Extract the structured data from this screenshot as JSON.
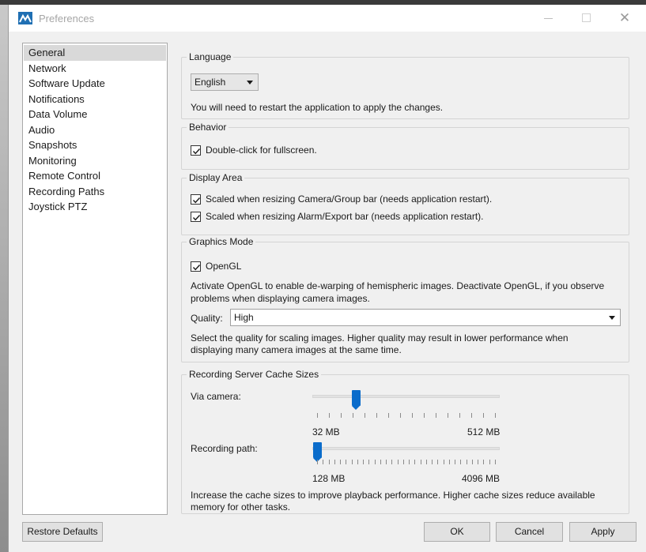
{
  "window": {
    "title": "Preferences",
    "icon": "milestone-logo-icon"
  },
  "sidebar": {
    "items": [
      {
        "label": "General",
        "selected": true
      },
      {
        "label": "Network"
      },
      {
        "label": "Software Update"
      },
      {
        "label": "Notifications"
      },
      {
        "label": "Data Volume"
      },
      {
        "label": "Audio"
      },
      {
        "label": "Snapshots"
      },
      {
        "label": "Monitoring"
      },
      {
        "label": "Remote Control"
      },
      {
        "label": "Recording Paths"
      },
      {
        "label": "Joystick PTZ"
      }
    ]
  },
  "language": {
    "title": "Language",
    "selected": "English",
    "note": "You will need to restart the application to apply the changes."
  },
  "behavior": {
    "title": "Behavior",
    "double_click_label": "Double-click for fullscreen.",
    "double_click_checked": true
  },
  "display_area": {
    "title": "Display Area",
    "camera_bar_label": "Scaled when resizing Camera/Group bar (needs application restart).",
    "camera_bar_checked": true,
    "alarm_bar_label": "Scaled when resizing Alarm/Export bar (needs application restart).",
    "alarm_bar_checked": true
  },
  "graphics": {
    "title": "Graphics Mode",
    "opengl_label": "OpenGL",
    "opengl_checked": true,
    "opengl_desc_1": "Activate OpenGL to enable de-warping of hemispheric images. Deactivate OpenGL, if you observe",
    "opengl_desc_2": "problems when displaying camera images.",
    "quality_label": "Quality:",
    "quality_value": "High",
    "quality_desc_1": "Select the quality for scaling images. Higher quality may result in lower performance when",
    "quality_desc_2": "displaying many camera images at the same time."
  },
  "cache": {
    "title": "Recording Server Cache Sizes",
    "via_camera_label": "Via camera:",
    "via_camera_min": "32 MB",
    "via_camera_max": "512 MB",
    "via_camera_level": 0.22,
    "recording_path_label": "Recording path:",
    "recording_path_min": "128 MB",
    "recording_path_max": "4096 MB",
    "recording_path_level": 0.0,
    "desc_1": "Increase the cache sizes to improve playback performance. Higher cache sizes reduce available",
    "desc_2": "memory for other tasks."
  },
  "footer": {
    "restore_label": "Restore Defaults",
    "ok_label": "OK",
    "cancel_label": "Cancel",
    "apply_label": "Apply"
  },
  "colors": {
    "slider_thumb": "#0a6ccb",
    "selected_item": "#d9d9d9",
    "window_bg": "#f0f0f0"
  }
}
